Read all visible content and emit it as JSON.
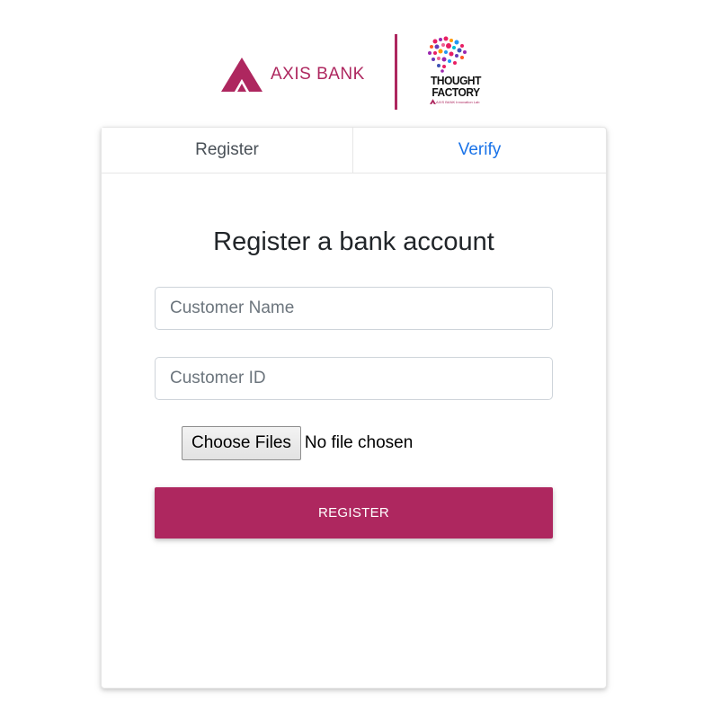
{
  "brand": {
    "bank_name": "AXIS BANK",
    "partner_line1": "THOUGHT",
    "partner_line2": "FACTORY",
    "partner_sub": "AXIS BANK Innovation Lab",
    "accent_color": "#ae275f"
  },
  "tabs": [
    {
      "label": "Register",
      "active": true
    },
    {
      "label": "Verify",
      "active": false
    }
  ],
  "form": {
    "title": "Register a bank account",
    "customer_name_placeholder": "Customer Name",
    "customer_name_value": "",
    "customer_id_placeholder": "Customer ID",
    "customer_id_value": "",
    "file_button_label": "Choose Files",
    "file_status": "No file chosen",
    "submit_label": "REGISTER"
  }
}
